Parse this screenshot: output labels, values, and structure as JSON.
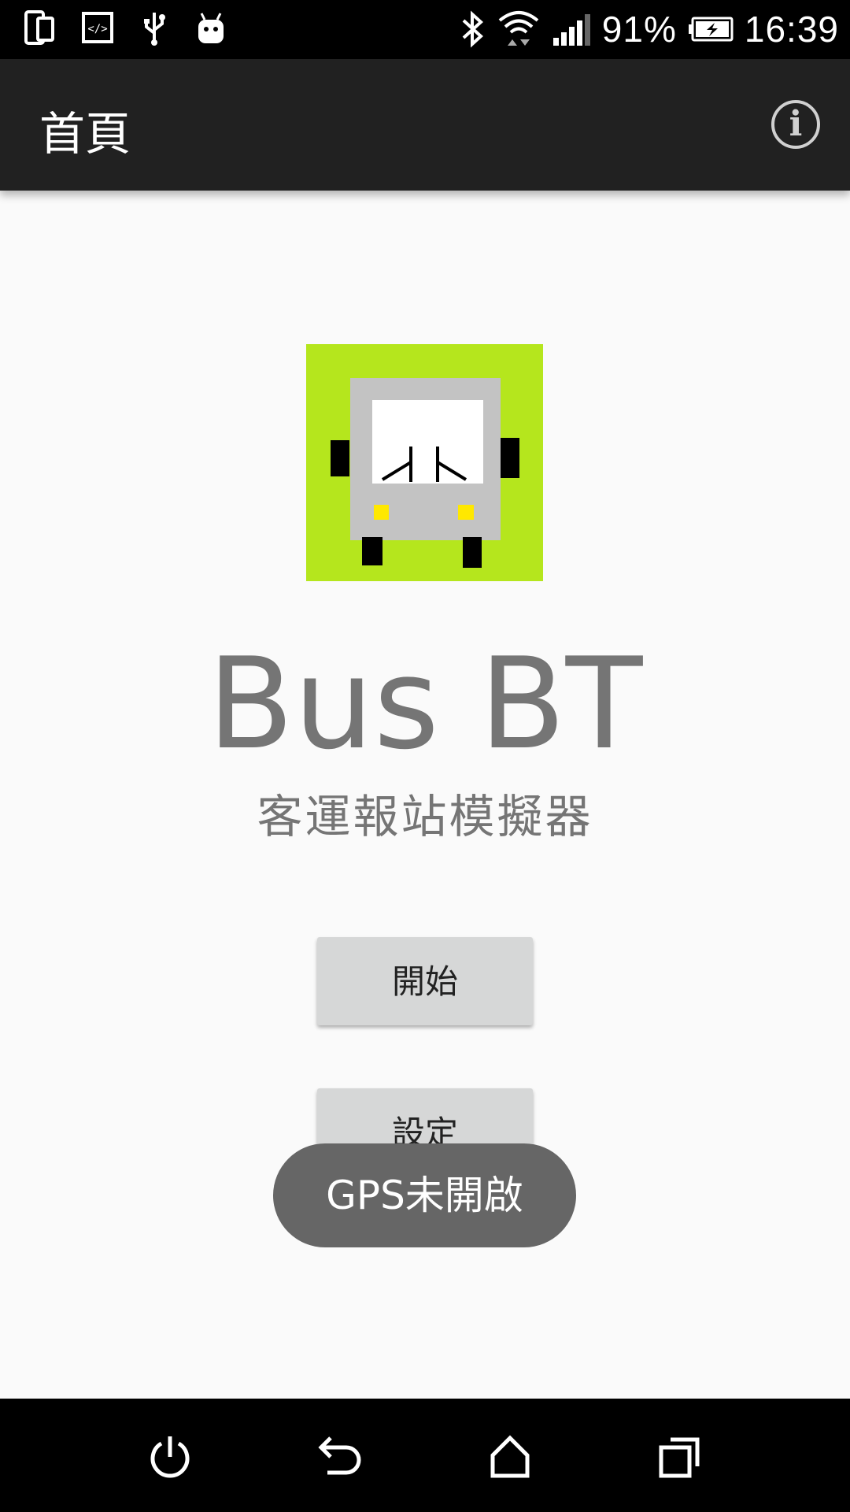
{
  "status_bar": {
    "battery_percent": "91%",
    "time": "16:39",
    "left_icons": [
      "device-icon",
      "code-icon",
      "usb-icon",
      "android-icon"
    ],
    "right_icons": [
      "bluetooth-icon",
      "wifi-icon",
      "signal-icon",
      "battery-charging-icon"
    ]
  },
  "app_bar": {
    "title": "首頁",
    "info_label": "i"
  },
  "main": {
    "app_name": "Bus BT",
    "subtitle": "客運報站模擬器",
    "start_button": "開始",
    "settings_button": "設定"
  },
  "toast": {
    "message": "GPS未開啟"
  },
  "nav_bar": {
    "icons": [
      "power-icon",
      "back-icon",
      "home-icon",
      "recents-icon"
    ]
  },
  "colors": {
    "logo_background": "#b5e61d",
    "bus_body": "#c3c3c3",
    "headlights": "#ffe800",
    "app_bar": "#212121",
    "toast": "#666666"
  }
}
